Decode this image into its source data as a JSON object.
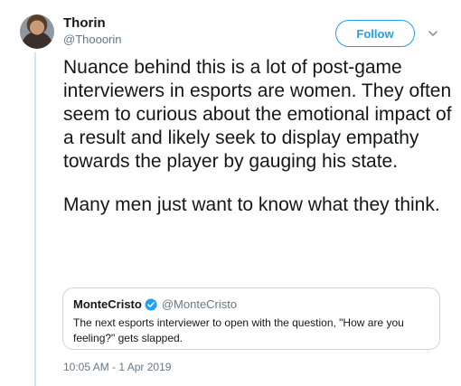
{
  "author": {
    "display_name": "Thorin",
    "handle": "@Thooorin"
  },
  "follow_button": {
    "label": "Follow"
  },
  "tweet": {
    "paragraphs": [
      "Nuance behind this is a lot of post-game interviewers in esports are women. They often seem to curious about the emotional impact of a result and likely seek to display empathy towards the player by gauging his state.",
      "Many men just want to know what they think."
    ],
    "timestamp": "10:05 AM - 1 Apr 2019"
  },
  "quote": {
    "display_name": "MonteCristo",
    "handle": "@MonteCristo",
    "text": "The next esports interviewer to open with the question, \"How are you feeling?\" gets slapped.",
    "verified_icon": "verified-badge-icon"
  },
  "colors": {
    "accent": "#1da1f2",
    "thread_line": "#cbe7f7",
    "muted_text": "#657786",
    "border": "#ccd6dd"
  },
  "icons": {
    "caret": "chevron-down-icon"
  }
}
